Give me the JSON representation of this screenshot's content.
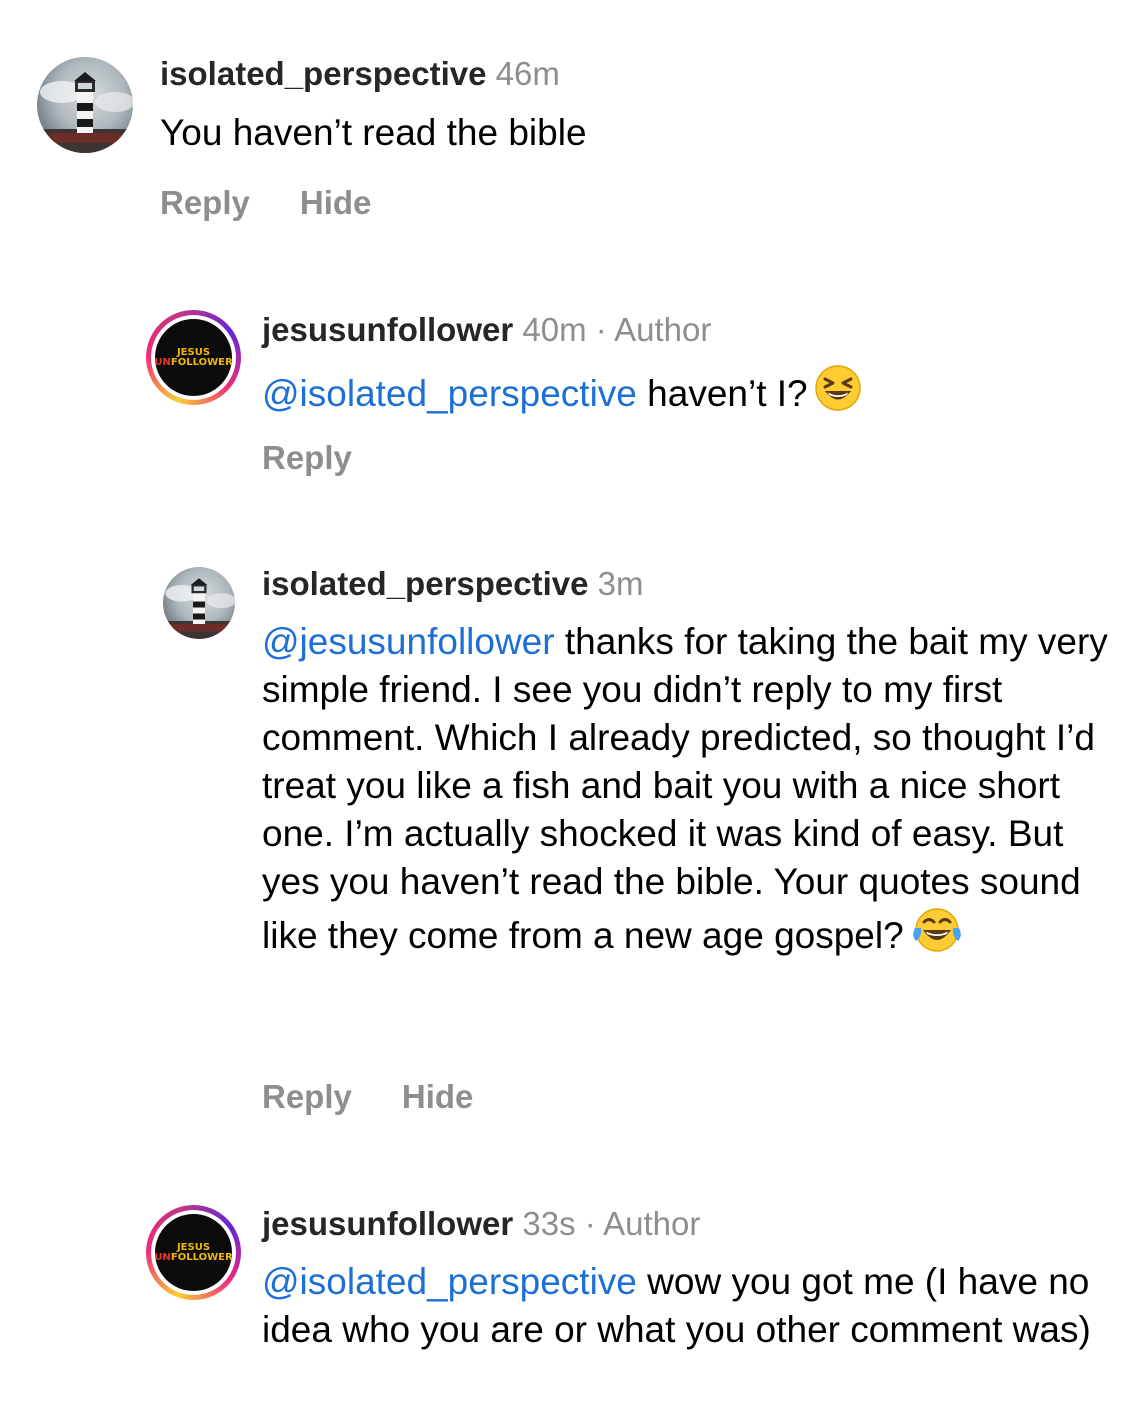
{
  "comments": [
    {
      "username": "isolated_perspective",
      "time": "46m",
      "body_text": "You haven’t read the bible",
      "actions": {
        "reply": "Reply",
        "hide": "Hide"
      }
    },
    {
      "username": "jesusunfollower",
      "time": "40m",
      "separator": "·",
      "badge": "Author",
      "mention": "@isolated_perspective",
      "body_text": " haven’t I?",
      "emoji": "grinning-squinting-face",
      "actions": {
        "reply": "Reply"
      },
      "avatar_logo": {
        "top": "JESUS",
        "un": "UN",
        "rest": "FOLLOWER"
      }
    },
    {
      "username": "isolated_perspective",
      "time": "3m",
      "mention": "@jesusunfollower",
      "body_text": " thanks for taking the bait my very simple friend. I see you didn’t reply to my first comment. Which I already predicted, so thought I’d treat you like a fish and bait you with a nice short one. I’m actually shocked it was kind of easy. But yes you haven’t read the bible. Your quotes sound like they come from a new age gospel?",
      "emoji": "face-with-tears-of-joy",
      "actions": {
        "reply": "Reply",
        "hide": "Hide"
      }
    },
    {
      "username": "jesusunfollower",
      "time": "33s",
      "separator": "·",
      "badge": "Author",
      "mention": "@isolated_perspective",
      "body_text": " wow you got me (I have no idea who you are or what you other comment was)",
      "avatar_logo": {
        "top": "JESUS",
        "un": "UN",
        "rest": "FOLLOWER"
      }
    }
  ],
  "colors": {
    "mention": "#1d6fd6",
    "muted": "#8e8e8e",
    "username": "#262626",
    "ring_gradient": [
      "#f9ce34",
      "#ee2a7b",
      "#6228d7"
    ]
  }
}
